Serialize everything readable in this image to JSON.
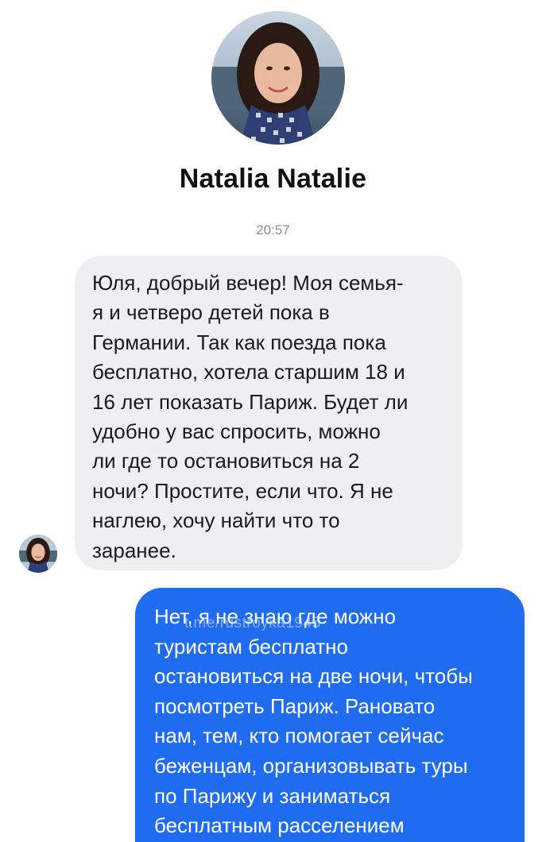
{
  "contact": {
    "name": "Natalia Natalie"
  },
  "timestamp": "20:57",
  "incoming_message": {
    "lines": [
      "Юля, добрый вечер! Моя семья-",
      "я и четверо детей пока в",
      "Германии. Так как поезда пока",
      "бесплатно, хотела старшим 18 и",
      "16 лет показать Париж. Будет ли",
      "удобно у вас спросить, можно",
      "ли где то остановиться на 2",
      "ночи? Простите, если что. Я не",
      "наглею, хочу найти что то",
      "заранее."
    ]
  },
  "outgoing_message": {
    "lines": [
      "Нет, я не знаю где можно",
      "туристам бесплатно",
      "остановиться на две ночи, чтобы",
      "посмотреть Париж. Рановато",
      "нам, тем, кто помогает сейчас",
      "беженцам, организовывать туры",
      "по Парижу и заниматься",
      "бесплатным расселением"
    ]
  },
  "watermark": "t.me/rustroyka1945",
  "colors": {
    "incoming_bubble": "#efeff2",
    "outgoing_bubble": "#1f6cf0",
    "timestamp": "#8e8e93"
  }
}
